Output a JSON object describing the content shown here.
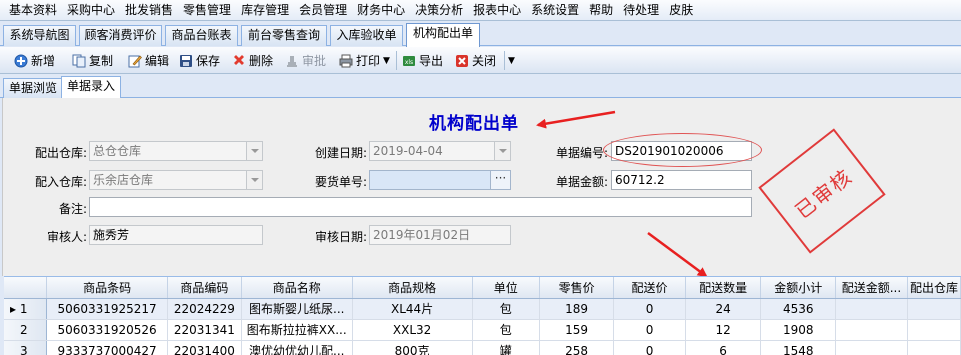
{
  "menu": [
    "基本资料",
    "采购中心",
    "批发销售",
    "零售管理",
    "库存管理",
    "会员管理",
    "财务中心",
    "决策分析",
    "报表中心",
    "系统设置",
    "帮助",
    "待处理",
    "皮肤"
  ],
  "tabs": [
    "系统导航图",
    "顾客消费评价",
    "商品台账表",
    "前台零售查询",
    "入库验收单",
    "机构配出单"
  ],
  "toolbar": {
    "new": "新增",
    "copy": "复制",
    "edit": "编辑",
    "save": "保存",
    "delete": "删除",
    "approve": "审批",
    "print": "打印",
    "export": "导出",
    "close": "关闭"
  },
  "subtabs": [
    "单据浏览",
    "单据录入"
  ],
  "form": {
    "title": "机构配出单",
    "out_wh_label": "配出仓库:",
    "out_wh_value": "总仓仓库",
    "in_wh_label": "配入仓库:",
    "in_wh_value": "乐余店仓库",
    "remark_label": "备注:",
    "remark_value": "",
    "auditor_label": "审核人:",
    "auditor_value": "施秀芳",
    "create_date_label": "创建日期:",
    "create_date_value": "2019-04-04",
    "req_no_label": "要货单号:",
    "req_no_value": "",
    "audit_date_label": "审核日期:",
    "audit_date_value": "2019年01月02日",
    "doc_no_label": "单据编号:",
    "doc_no_value": "DS201901020006",
    "amount_label": "单据金额:",
    "amount_value": "60712.2",
    "stamp": "已审核",
    "ellipsis": "···"
  },
  "grid": {
    "columns": [
      "",
      "商品条码",
      "商品编码",
      "商品名称",
      "商品规格",
      "单位",
      "零售价",
      "配送价",
      "配送数量",
      "金额小计",
      "配送金额...",
      "配出仓库"
    ],
    "rows": [
      {
        "marker": "▸ 1",
        "barcode": "5060331925217",
        "code": "22024229",
        "name": "图布斯婴儿纸尿...",
        "spec": "XL44片",
        "unit": "包",
        "retail": "189",
        "dist_price": "0",
        "qty": "24",
        "subtotal": "4536",
        "dist_amount": "",
        "out_wh": ""
      },
      {
        "marker": "2",
        "barcode": "5060331920526",
        "code": "22031341",
        "name": "图布斯拉拉裤XX...",
        "spec": "XXL32",
        "unit": "包",
        "retail": "159",
        "dist_price": "0",
        "qty": "12",
        "subtotal": "1908",
        "dist_amount": "",
        "out_wh": ""
      },
      {
        "marker": "3",
        "barcode": "9333737000427",
        "code": "22031400",
        "name": "澳优幼优幼儿配...",
        "spec": "800克",
        "unit": "罐",
        "retail": "258",
        "dist_price": "0",
        "qty": "6",
        "subtotal": "1548",
        "dist_amount": "",
        "out_wh": ""
      }
    ]
  }
}
